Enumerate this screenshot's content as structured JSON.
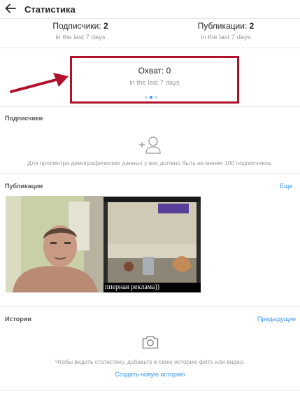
{
  "header": {
    "title": "Статистика"
  },
  "stats": {
    "followers": {
      "label": "Подписчики: ",
      "value": "2",
      "period": "in the last 7 days"
    },
    "posts": {
      "label": "Публикации: ",
      "value": "2",
      "period": "in the last 7 days"
    }
  },
  "reach": {
    "label": "Охват: 0",
    "period": "in the last 7 days",
    "pager": {
      "pages": 3,
      "current": 2
    }
  },
  "followers_section": {
    "title": "Подписчики",
    "note": "Для просмотра демографических данных у вас должно быть не менее 100 подписчиков."
  },
  "posts_section": {
    "title": "Публикации",
    "more_link": "Еще",
    "items": [
      {
        "caption": ""
      },
      {
        "caption": "пперная реклама))"
      }
    ]
  },
  "stories_section": {
    "title": "Истории",
    "prev_link": "Предыдущие",
    "note": "Чтобы видеть статистику, добавьте в свою историю фото или видео.",
    "create_link": "Создать новую историю"
  },
  "icons": {
    "back": "arrow-left-icon",
    "add_person": "add-person-icon",
    "camera": "camera-icon",
    "annotation": "red-arrow"
  },
  "colors": {
    "accent": "#3897f0",
    "annotation": "#b0112a",
    "muted": "#999999"
  }
}
